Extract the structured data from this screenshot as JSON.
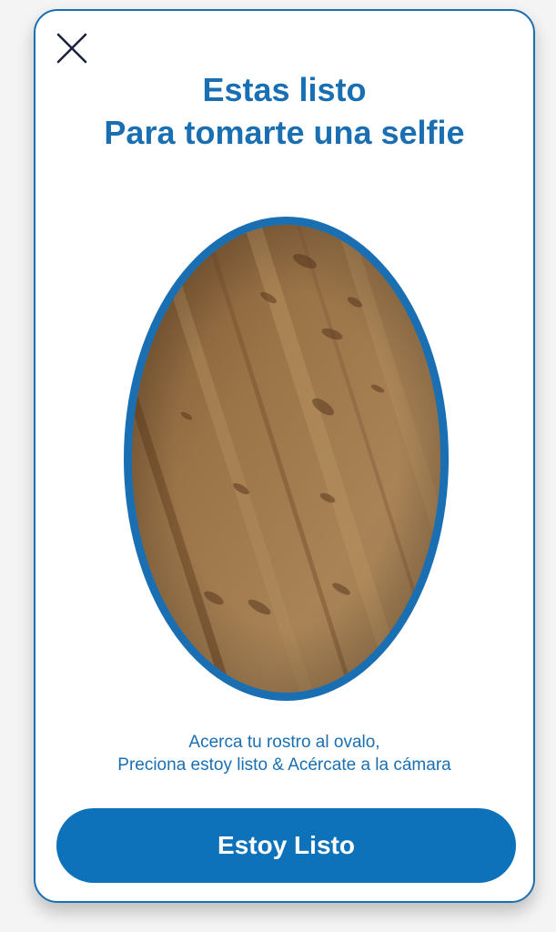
{
  "dialog": {
    "close_icon": "close-icon",
    "title_line1": "Estas listo",
    "title_line2": "Para tomarte una selfie",
    "hint_line1": "Acerca tu rostro al ovalo,",
    "hint_line2": "Preciona estoy listo & Acércate a la cámara",
    "primary_button_label": "Estoy Listo"
  },
  "colors": {
    "accent": "#1a6fb3",
    "button": "#0d72b9",
    "card_background": "#ffffff",
    "page_background": "#f4f4f4"
  }
}
